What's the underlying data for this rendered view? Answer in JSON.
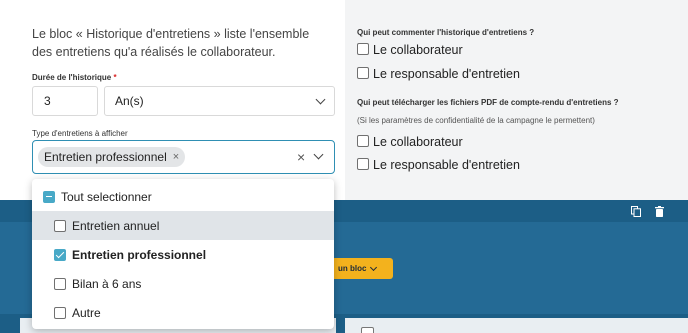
{
  "left": {
    "info_text": "Le bloc « Historique d'entretiens » liste l'ensemble des entretiens qu'a réalisés le collaborateur.",
    "duration_label": "Durée de l'historique",
    "required_mark": "*",
    "duration_value": "3",
    "duration_unit": "An(s)",
    "types_label": "Type d'entretiens à afficher",
    "selected_tag": "Entretien professionnel",
    "tag_remove": "×",
    "clear": "×"
  },
  "dropdown": {
    "select_all": "Tout selectionner",
    "options": [
      {
        "label": "Entretien annuel",
        "checked": false
      },
      {
        "label": "Entretien professionnel",
        "checked": true
      },
      {
        "label": "Bilan à 6 ans",
        "checked": false
      },
      {
        "label": "Autre",
        "checked": false
      }
    ]
  },
  "right": {
    "comment_question": "Qui peut commenter l'historique d'entretiens ?",
    "comment_options": [
      "Le collaborateur",
      "Le responsable d'entretien"
    ],
    "download_question": "Qui peut télécharger les fichiers PDF de compte-rendu d'entretiens ?",
    "download_note": "(Si les paramètres de confidentialité de la campagne le permettent)",
    "download_options": [
      "Le collaborateur",
      "Le responsable d'entretien"
    ]
  },
  "toolbar": {
    "add_block_label": "un bloc"
  },
  "icons": {
    "copy": "copy-icon",
    "trash": "trash-icon",
    "chevron": "chevron-down-icon"
  },
  "colors": {
    "accent": "#48a9c7",
    "primary_blue": "#1c5e86",
    "button_yellow": "#f3b21d",
    "required": "#d92525"
  }
}
